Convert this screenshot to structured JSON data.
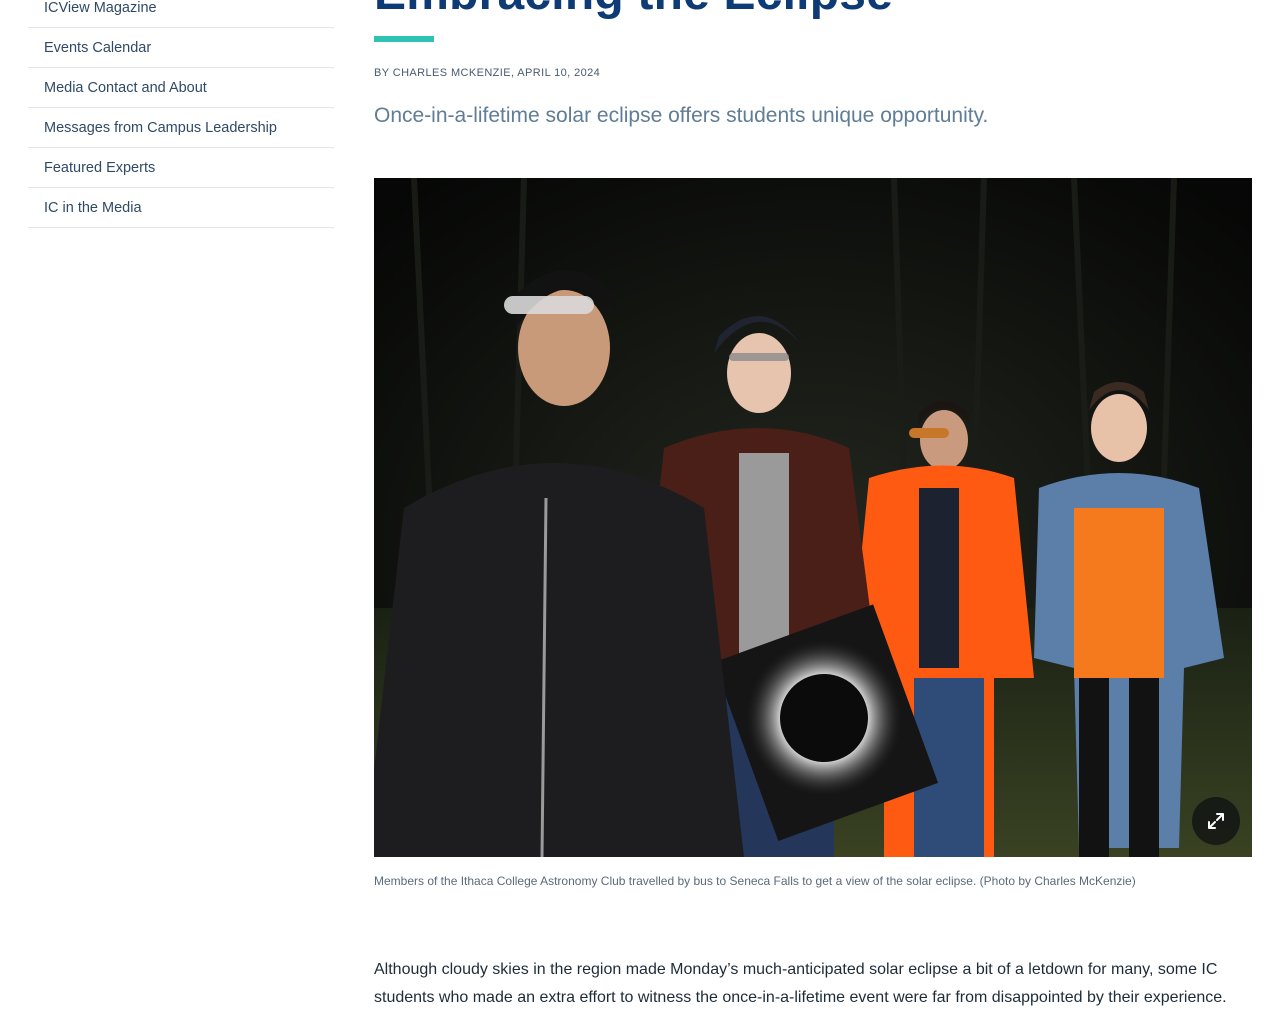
{
  "sidebar": {
    "items": [
      {
        "label": "ICView Magazine"
      },
      {
        "label": "Events Calendar"
      },
      {
        "label": "Media Contact and About"
      },
      {
        "label": "Messages from Campus Leadership"
      },
      {
        "label": "Featured Experts"
      },
      {
        "label": "IC in the Media"
      }
    ]
  },
  "article": {
    "title": "Embracing the Eclipse",
    "byline": "By Charles McKenzie, April 10, 2024",
    "dek": "Once-in-a-lifetime solar eclipse offers students unique opportunity.",
    "image": {
      "icon": "expand-icon"
    },
    "caption": "Members of the Ithaca College Astronomy Club travelled by bus to Seneca Falls to get a view of the solar eclipse. (Photo by Charles McKenzie)",
    "body": "Although cloudy skies in the region made Monday’s much-anticipated solar eclipse a bit of a letdown for many, some IC students who made an extra effort to witness the once-in-a-lifetime event were far from disappointed by their experience."
  },
  "colors": {
    "title": "#0e3a75",
    "accent_rule": "#2fc4b2",
    "link": "#2f4a66",
    "dek": "#5f7d96"
  }
}
